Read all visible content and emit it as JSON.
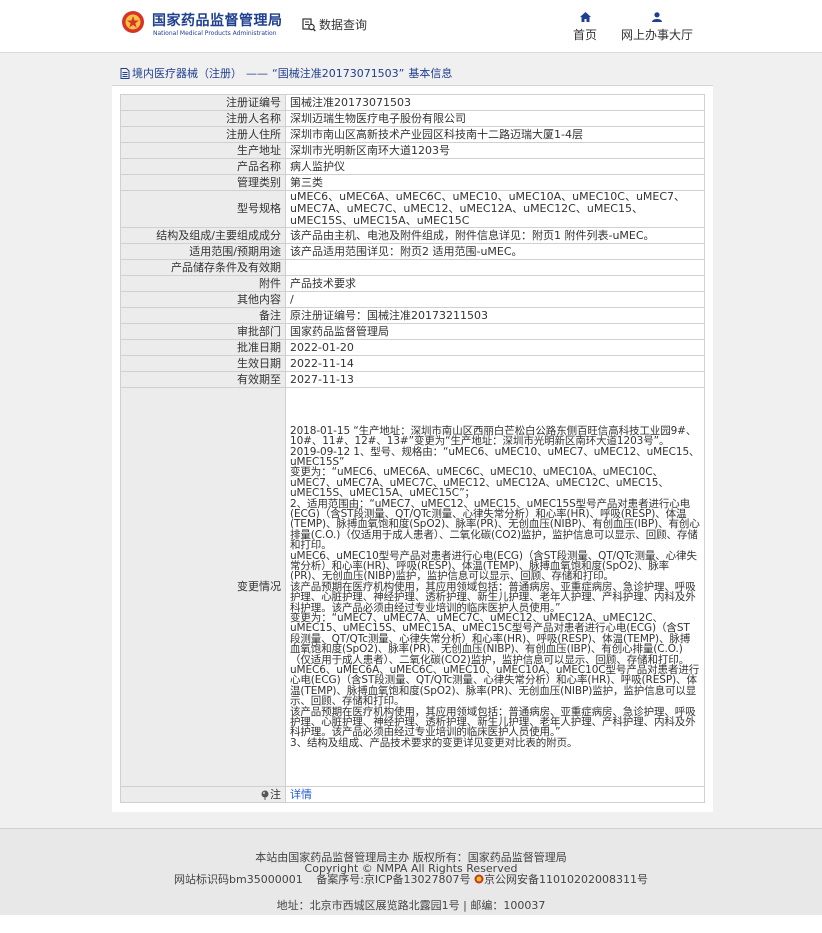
{
  "header": {
    "logo_cn": "国家药品监督管理局",
    "logo_en": "National Medical Products Administration",
    "data_query": "数据查询",
    "nav_home": "首页",
    "nav_hall": "网上办事大厅"
  },
  "breadcrumb": {
    "category": "境内医疗器械（注册）",
    "sep": "——",
    "record": "“国械注准20173071503”",
    "suffix": "基本信息"
  },
  "rows": [
    {
      "label": "注册证编号",
      "value": "国械注准20173071503"
    },
    {
      "label": "注册人名称",
      "value": "深圳迈瑞生物医疗电子股份有限公司"
    },
    {
      "label": "注册人住所",
      "value": "深圳市南山区高新技术产业园区科技南十二路迈瑞大厦1-4层"
    },
    {
      "label": "生产地址",
      "value": "深圳市光明新区南环大道1203号"
    },
    {
      "label": "产品名称",
      "value": "病人监护仪"
    },
    {
      "label": "管理类别",
      "value": "第三类"
    },
    {
      "label": "型号规格",
      "value": "uMEC6、uMEC6A、uMEC6C、uMEC10、uMEC10A、uMEC10C、uMEC7、uMEC7A、uMEC7C、uMEC12、uMEC12A、uMEC12C、uMEC15、uMEC15S、uMEC15A、uMEC15C"
    },
    {
      "label": "结构及组成/主要组成成分",
      "value": "该产品由主机、电池及附件组成，附件信息详见：附页1 附件列表-uMEC。"
    },
    {
      "label": "适用范围/预期用途",
      "value": "该产品适用范围详见：附页2 适用范围-uMEC。"
    },
    {
      "label": "产品储存条件及有效期",
      "value": ""
    },
    {
      "label": "附件",
      "value": "产品技术要求"
    },
    {
      "label": "其他内容",
      "value": "/"
    },
    {
      "label": "备注",
      "value": "原注册证编号：国械注准20173211503"
    },
    {
      "label": "审批部门",
      "value": "国家药品监督管理局"
    },
    {
      "label": "批准日期",
      "value": "2022-01-20"
    },
    {
      "label": "生效日期",
      "value": "2022-11-14"
    },
    {
      "label": "有效期至",
      "value": "2027-11-13"
    }
  ],
  "change": {
    "label": "变更情况",
    "text": "2018-01-15 “生产地址：深圳市南山区西丽白芒松白公路东侧百旺信高科技工业园9#、10#、11#、12#、13#”变更为“生产地址：深圳市光明新区南环大道1203号”。\n2019-09-12 1、型号、规格由：“uMEC6、uMEC10、uMEC7、uMEC12、uMEC15、uMEC15S”\n变更为：“uMEC6、uMEC6A、uMEC6C、uMEC10、uMEC10A、uMEC10C、uMEC7、uMEC7A、uMEC7C、uMEC12、uMEC12A、uMEC12C、uMEC15、uMEC15S、uMEC15A、uMEC15C”；\n2、适用范围由：“uMEC7、uMEC12、uMEC15、uMEC15S型号产品对患者进行心电(ECG)（含ST段测量、QT/QTc测量、心律失常分析）和心率(HR)、呼吸(RESP)、体温(TEMP)、脉搏血氧饱和度(SpO2)、脉率(PR)、无创血压(NIBP)、有创血压(IBP)、有创心排量(C.O.)（仅适用于成人患者）、二氧化碳(CO2)监护，监护信息可以显示、回顾、存储和打印。\nuMEC6、uMEC10型号产品对患者进行心电(ECG)（含ST段测量、QT/QTc测量、心律失常分析）和心率(HR)、呼吸(RESP)、体温(TEMP)、脉搏血氧饱和度(SpO2)、脉率(PR)、无创血压(NIBP)监护，监护信息可以显示、回顾、存储和打印。\n该产品预期在医疗机构使用，其应用领域包括：普通病房、亚重症病房、急诊护理、呼吸护理、心脏护理、神经护理、透析护理、新生儿护理、老年人护理、产科护理、内科及外科护理。该产品必须由经过专业培训的临床医护人员使用。”\n变更为：“uMEC7、uMEC7A、uMEC7C、uMEC12、uMEC12A、uMEC12C、uMEC15、uMEC15S、uMEC15A、uMEC15C型号产品对患者进行心电(ECG)（含ST段测量、QT/QTc测量、心律失常分析）和心率(HR)、呼吸(RESP)、体温(TEMP)、脉搏血氧饱和度(SpO2)、脉率(PR)、无创血压(NIBP)、有创血压(IBP)、有创心排量(C.O.)（仅适用于成人患者）、二氧化碳(CO2)监护，监护信息可以显示、回顾、存储和打印。\nuMEC6、uMEC6A、uMEC6C、uMEC10、uMEC10A、uMEC10C型号产品对患者进行心电(ECG)（含ST段测量、QT/QTc测量、心律失常分析）和心率(HR)、呼吸(RESP)、体温(TEMP)、脉搏血氧饱和度(SpO2)、脉率(PR)、无创血压(NIBP)监护，监护信息可以显示、回顾、存储和打印。\n该产品预期在医疗机构使用，其应用领域包括：普通病房、亚重症病房、急诊护理、呼吸护理、心脏护理、神经护理、透析护理、新生儿护理、老年人护理、产科护理、内科及外科护理。该产品必须由经过专业培训的临床医护人员使用。”\n3、结构及组成、产品技术要求的变更详见变更对比表的附页。"
  },
  "note": {
    "label": "注",
    "link": "详情"
  },
  "footer": {
    "line1": "本站由国家药品监督管理局主办 版权所有：国家药品监督管理局",
    "line2": "Copyright © NMPA All Rights Reserved",
    "icp_id": "网站标识码bm35000001",
    "icp_record": "备案序号:京ICP备13027807号",
    "police_record": "京公网安备11010202008311号",
    "address": "地址：北京市西城区展览路北露园1号 | 邮编：100037"
  },
  "colors": {
    "brand": "#1f3f8f",
    "link": "#1f5bd1",
    "label_bg": "#ececec"
  }
}
